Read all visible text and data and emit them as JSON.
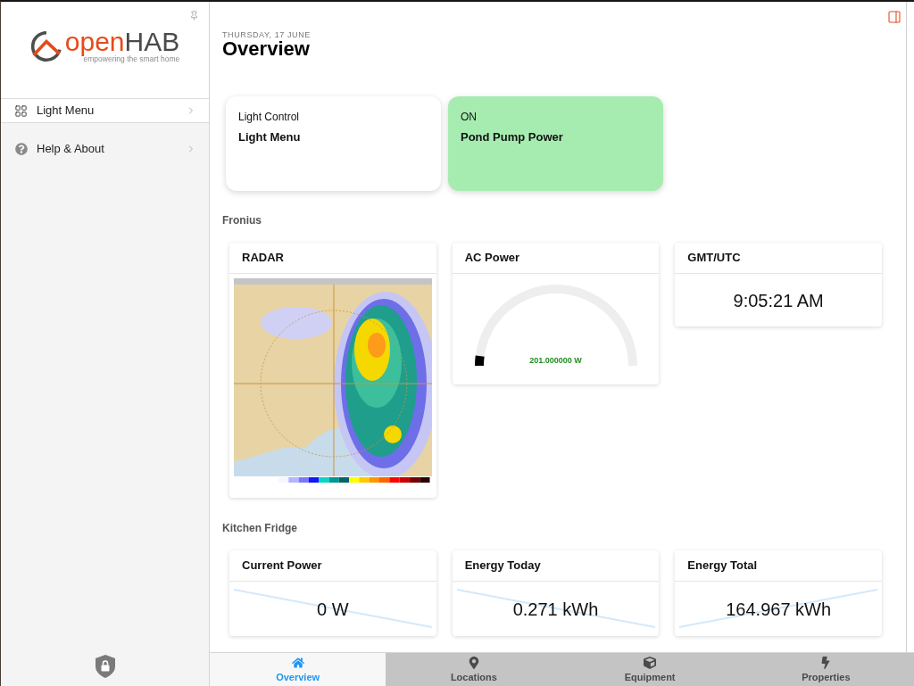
{
  "sidebar": {
    "logo": {
      "name_start": "open",
      "name_end": "HAB",
      "tagline": "empowering the smart home"
    },
    "pages": [
      {
        "label": "Light Menu"
      }
    ],
    "help": {
      "label": "Help & About"
    }
  },
  "header": {
    "date": "THURSDAY, 17 JUNE",
    "title": "Overview"
  },
  "cells": [
    {
      "caption": "Light Control",
      "title": "Light Menu",
      "on": false
    },
    {
      "caption": "ON",
      "title": "Pond Pump Power",
      "on": true
    }
  ],
  "sections": [
    {
      "title": "Fronius",
      "widgets": [
        {
          "kind": "image",
          "title": "RADAR"
        },
        {
          "kind": "gauge",
          "title": "AC Power",
          "level": 0.04,
          "reading": "201.000000 W"
        },
        {
          "kind": "value",
          "title": "GMT/UTC",
          "value": "9:05:21 AM"
        }
      ]
    },
    {
      "title": "Kitchen Fridge",
      "widgets": [
        {
          "kind": "falling",
          "title": "Current Power",
          "value": "0 W"
        },
        {
          "kind": "falling",
          "title": "Energy Today",
          "value": "0.271 kWh"
        },
        {
          "kind": "rising",
          "title": "Energy Total",
          "value": "164.967 kWh"
        }
      ]
    }
  ],
  "tabs": [
    {
      "label": "Overview",
      "selected": true
    },
    {
      "label": "Locations",
      "selected": false
    },
    {
      "label": "Equipment",
      "selected": false
    },
    {
      "label": "Properties",
      "selected": false
    }
  ]
}
